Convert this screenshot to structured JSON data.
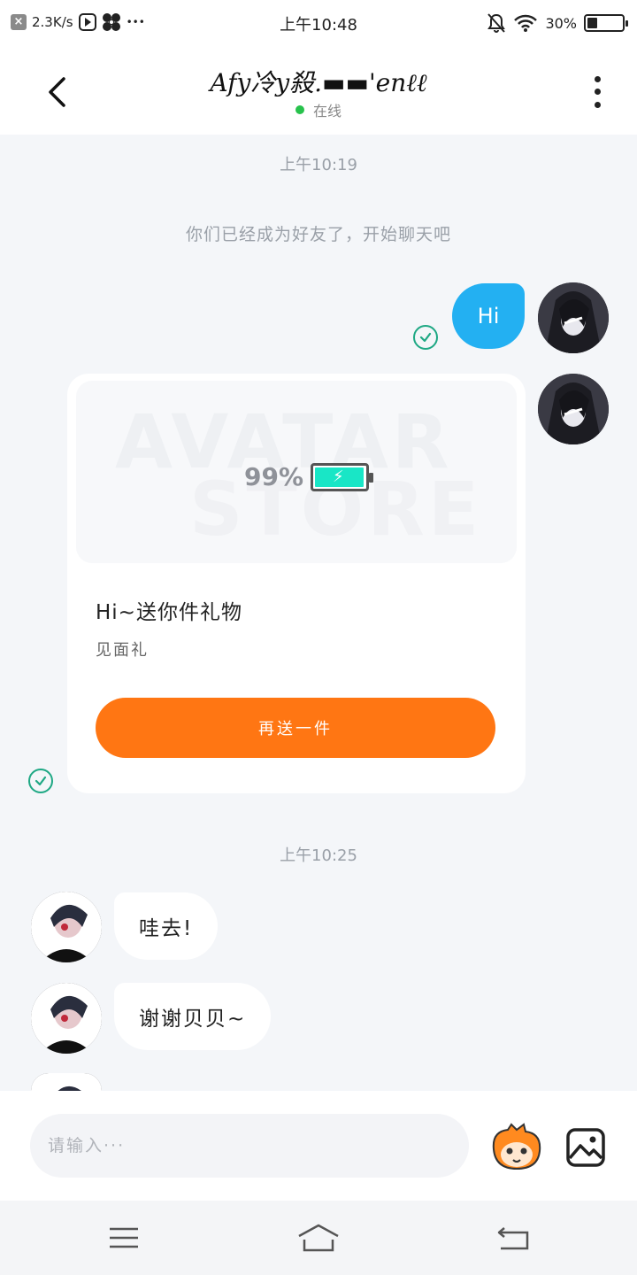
{
  "status_bar": {
    "net_speed": "2.3K/s",
    "time": "上午10:48",
    "battery": "30%",
    "battery_level": 0.3,
    "icons": [
      "close-notify-icon",
      "play-icon",
      "fan-icon",
      "more-dots-icon",
      "mute-bell-icon",
      "wifi-icon",
      "battery-icon"
    ],
    "more_dots": "•••"
  },
  "header": {
    "title": "Afy冷y殺.▬▬'enℓℓ",
    "status": "在线",
    "status_color": "#27c24c"
  },
  "chat": {
    "time_1": "上午10:19",
    "system_message": "你们已经成为好友了，开始聊天吧",
    "my_message": "Hi",
    "gift_card": {
      "watermark_line1": "AVATAR",
      "watermark_line2": "STORE",
      "battery_percent": "99%",
      "bolt": "⚡",
      "title": "Hi~送你件礼物",
      "subtitle": "见面礼",
      "button": "再送一件",
      "button_color": "#ff7613"
    },
    "time_2": "上午10:25",
    "their_messages": [
      "哇去!",
      "谢谢贝贝~"
    ]
  },
  "input": {
    "placeholder": "请输入···"
  },
  "colors": {
    "my_bubble": "#23b0f2",
    "check": "#1ea884",
    "background": "#f4f6f9"
  }
}
